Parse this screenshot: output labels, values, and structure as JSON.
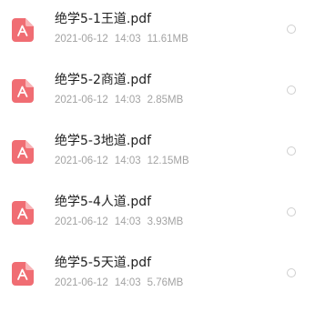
{
  "theme": {
    "pdf_icon_color": "#f06d73",
    "name_color": "#1f1f1f",
    "meta_color": "#a3a3a3"
  },
  "files": [
    {
      "name": "绝学5-1王道.pdf",
      "date": "2021-06-12",
      "time": "14:03",
      "size": "11.61MB",
      "icon": "pdf-icon",
      "selected": false
    },
    {
      "name": "绝学5-2商道.pdf",
      "date": "2021-06-12",
      "time": "14:03",
      "size": "2.85MB",
      "icon": "pdf-icon",
      "selected": false
    },
    {
      "name": "绝学5-3地道.pdf",
      "date": "2021-06-12",
      "time": "14:03",
      "size": "12.15MB",
      "icon": "pdf-icon",
      "selected": false
    },
    {
      "name": "绝学5-4人道.pdf",
      "date": "2021-06-12",
      "time": "14:03",
      "size": "3.93MB",
      "icon": "pdf-icon",
      "selected": false
    },
    {
      "name": "绝学5-5天道.pdf",
      "date": "2021-06-12",
      "time": "14:03",
      "size": "5.76MB",
      "icon": "pdf-icon",
      "selected": false
    }
  ]
}
